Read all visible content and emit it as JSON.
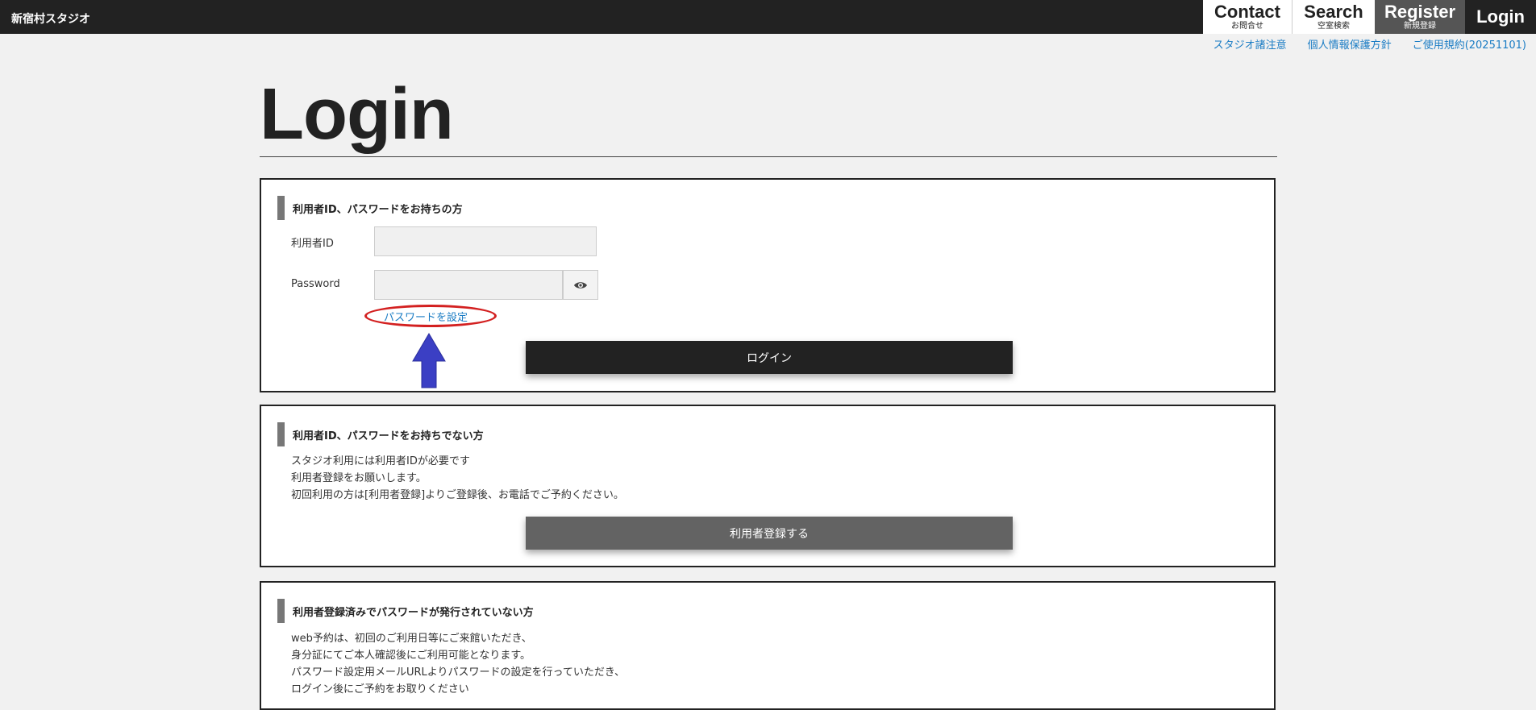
{
  "header": {
    "site_name": "新宿村スタジオ",
    "nav": [
      {
        "main": "Contact",
        "sub": "お問合せ"
      },
      {
        "main": "Search",
        "sub": "空室検索"
      },
      {
        "main": "Register",
        "sub": "新規登録"
      },
      {
        "main": "Login",
        "sub": ""
      }
    ],
    "links": [
      "スタジオ諸注意",
      "個人情報保護方針",
      "ご使用規約(20251101)"
    ]
  },
  "page_title": "Login",
  "section1": {
    "heading": "利用者ID、パスワードをお持ちの方",
    "user_id_label": "利用者ID",
    "user_id_value": "",
    "password_label": "Password",
    "password_value": "",
    "set_password_link": "パスワードを設定",
    "login_button": "ログイン"
  },
  "section2": {
    "heading": "利用者ID、パスワードをお持ちでない方",
    "lines": [
      "スタジオ利用には利用者IDが必要です",
      "利用者登録をお願いします。",
      "初回利用の方は[利用者登録]よりご登録後、お電話でご予約ください。"
    ],
    "register_button": "利用者登録する"
  },
  "section3": {
    "heading": "利用者登録済みでパスワードが発行されていない方",
    "lines": [
      "web予約は、初回のご利用日等にご来館いただき、",
      "身分証にてご本人確認後にご利用可能となります。",
      "パスワード設定用メールURLよりパスワードの設定を行っていただき、",
      "ログイン後にご予約をお取りください"
    ]
  },
  "annotation_colors": {
    "oval": "#d32020",
    "arrow": "#3b3fc4"
  }
}
